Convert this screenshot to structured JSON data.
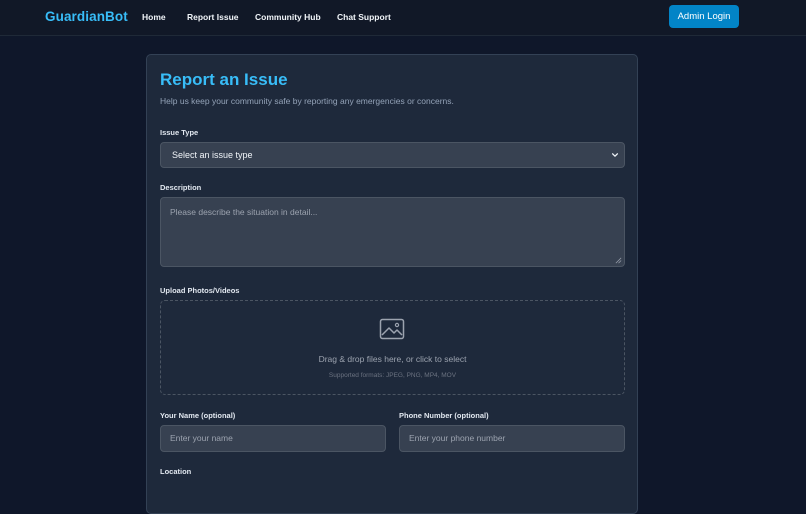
{
  "nav": {
    "brand": "GuardianBot",
    "links": [
      "Home",
      "Report Issue",
      "Community Hub",
      "Chat Support"
    ],
    "admin_button": "Admin Login"
  },
  "form": {
    "title": "Report an Issue",
    "subtitle": "Help us keep your community safe by reporting any emergencies or concerns.",
    "issue_type": {
      "label": "Issue Type",
      "selected": "Select an issue type",
      "icon": "chevron-down-icon"
    },
    "description": {
      "label": "Description",
      "placeholder": "Please describe the situation in detail..."
    },
    "upload": {
      "label": "Upload Photos/Videos",
      "icon": "image-icon",
      "text": "Drag & drop files here, or click to select",
      "formats": "Supported formats: JPEG, PNG, MP4, MOV"
    },
    "name": {
      "label": "Your Name (optional)",
      "placeholder": "Enter your name"
    },
    "phone": {
      "label": "Phone Number (optional)",
      "placeholder": "Enter your phone number"
    },
    "location": {
      "label": "Location"
    }
  },
  "colors": {
    "page_bg": "#0f172a",
    "card_bg": "#1e293b",
    "accent": "#38bdf8",
    "button": "#0284c7",
    "field_bg": "#374151"
  }
}
